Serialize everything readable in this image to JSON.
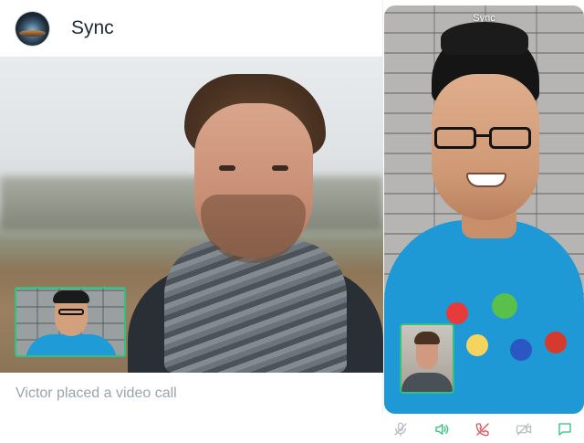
{
  "chat": {
    "title": "Sync",
    "message": "Victor placed a video call"
  },
  "phone": {
    "title": "Sync"
  },
  "controls": [
    {
      "name": "mute-microphone",
      "icon": "microphone-muted-icon",
      "color": "#b7bec4"
    },
    {
      "name": "speaker",
      "icon": "speaker-icon",
      "color": "#2ec27e"
    },
    {
      "name": "end-call",
      "icon": "phone-hangup-icon",
      "color": "#e2545a"
    },
    {
      "name": "camera-off",
      "icon": "video-camera-off-icon",
      "color": "#b7bec4"
    },
    {
      "name": "chat",
      "icon": "chat-bubble-icon",
      "color": "#2ec27e"
    }
  ],
  "colors": {
    "accent": "#2ec27e",
    "danger": "#e2545a",
    "muted": "#b7bec4",
    "title_text": "#202a33",
    "message_text": "#9aa4ab"
  }
}
